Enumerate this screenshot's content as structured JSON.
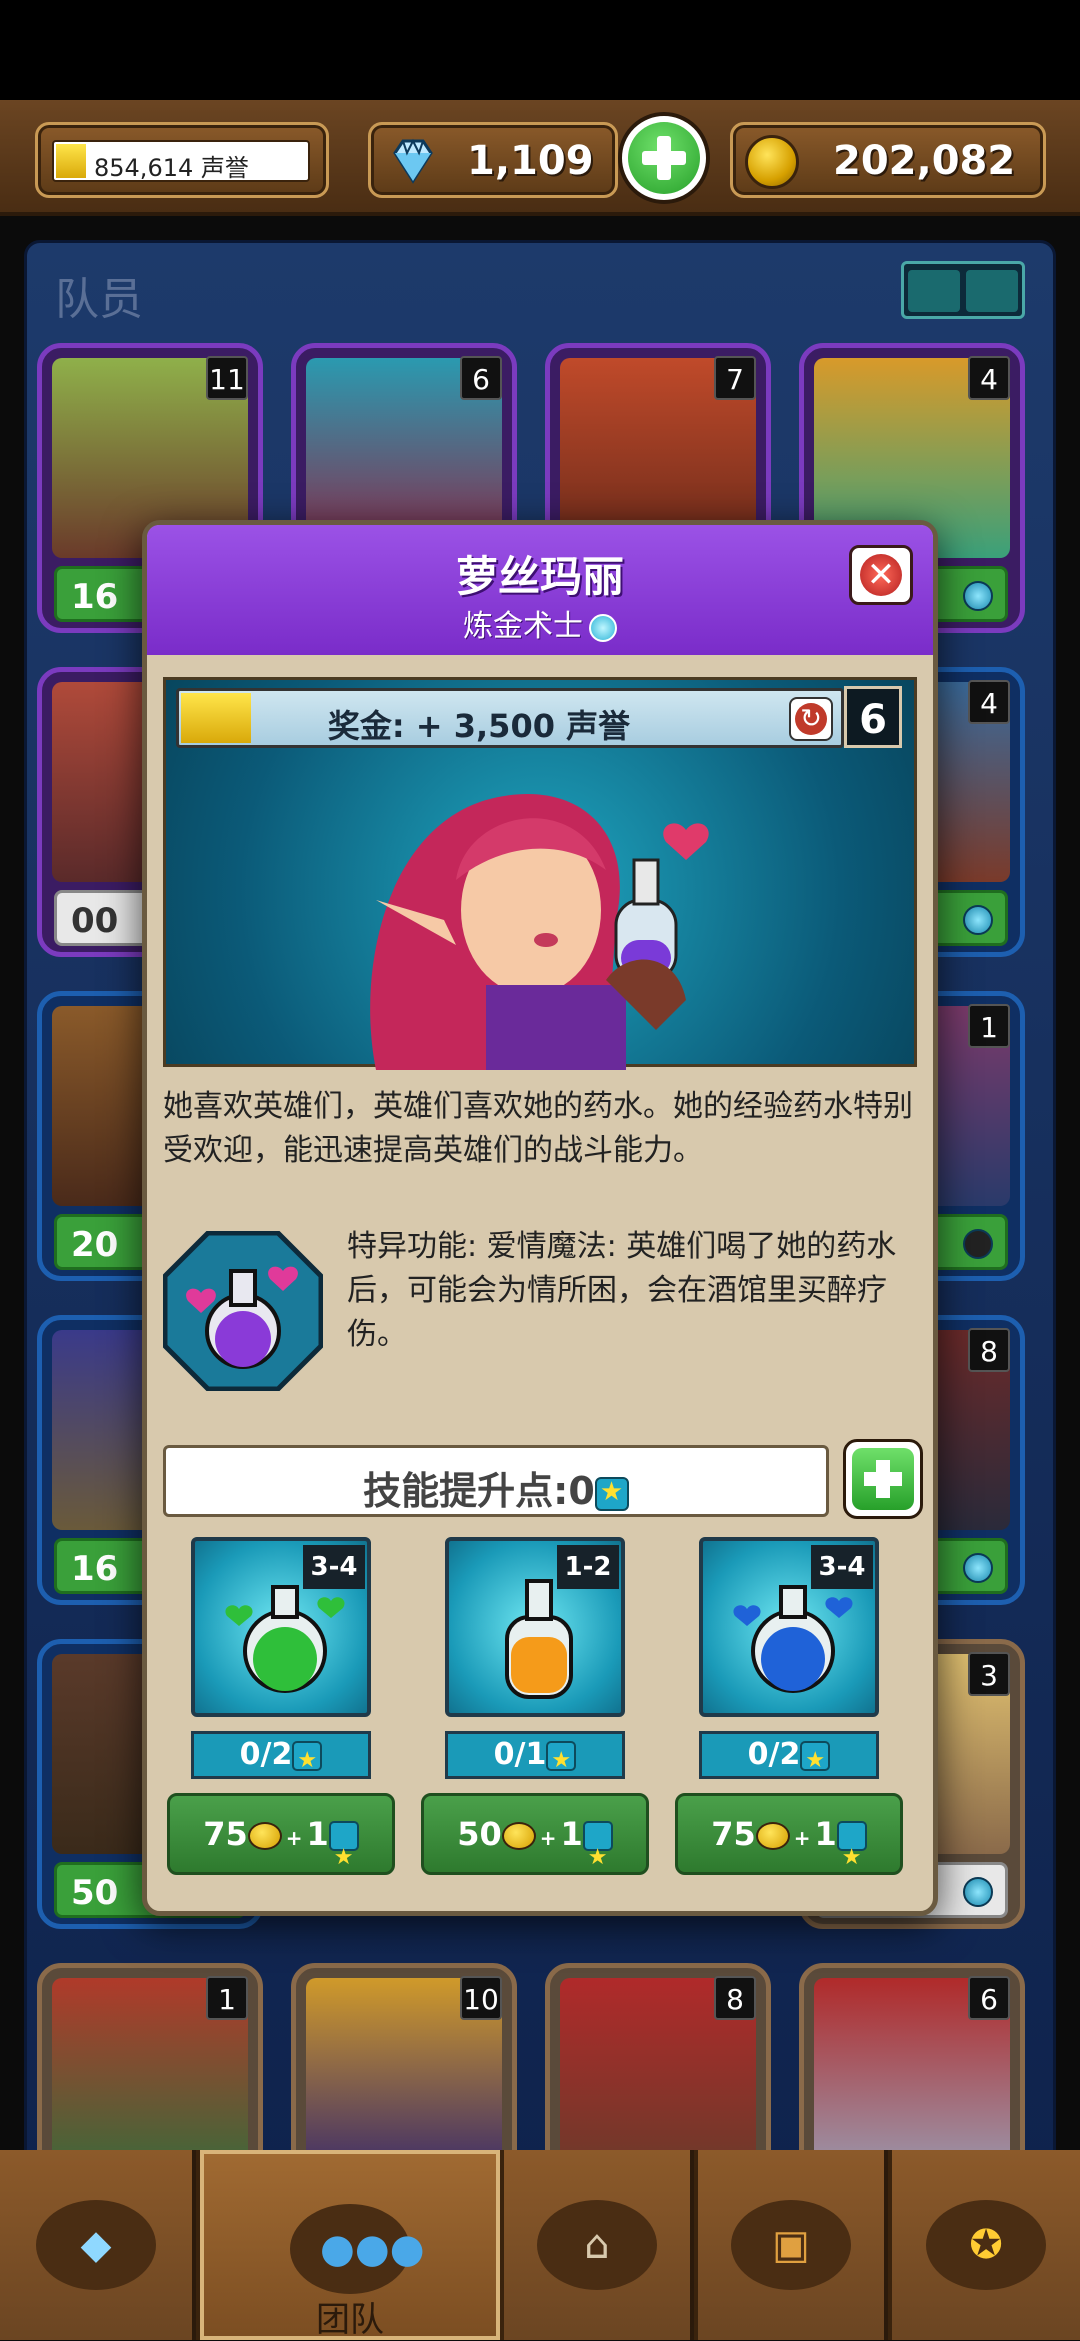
{
  "topbar": {
    "reputation": "854,614 声誉",
    "gems": "1,109",
    "gold": "202,082"
  },
  "roster": {
    "title": "队员",
    "cards": [
      {
        "level": "11",
        "foot": "16"
      },
      {
        "level": "6",
        "foot": ""
      },
      {
        "level": "7",
        "foot": ""
      },
      {
        "level": "4",
        "foot": ""
      },
      {
        "level": "",
        "foot": "00"
      },
      {
        "level": "4",
        "foot": ""
      },
      {
        "level": "",
        "foot": "20"
      },
      {
        "level": "1",
        "foot": ""
      },
      {
        "level": "",
        "foot": "16"
      },
      {
        "level": "8",
        "foot": ""
      },
      {
        "level": "",
        "foot": "50"
      },
      {
        "level": "3",
        "foot": ""
      },
      {
        "level": "1",
        "foot": ""
      },
      {
        "level": "10",
        "foot": ""
      },
      {
        "level": "8",
        "foot": ""
      },
      {
        "level": "6",
        "foot": ""
      }
    ]
  },
  "modal": {
    "name": "萝丝玛丽",
    "class": "炼金术士",
    "bonus": "奖金: + 3,500 声誉",
    "level": "6",
    "description": "她喜欢英雄们，英雄们喜欢她的药水。她的经验药水特别受欢迎，能迅速提高英雄们的战斗能力。",
    "trait": "特异功能: 爱情魔法: 英雄们喝了她的药水后，可能会为情所困，会在酒馆里买醉疗伤。",
    "skill_points": "技能提升点:0",
    "skills": [
      {
        "range": "3-4",
        "progress": "0/2",
        "cost_gold": "75",
        "cost_star": "1",
        "potion": "green-potion-icon",
        "color": "#2fbf3a"
      },
      {
        "range": "1-2",
        "progress": "0/1",
        "cost_gold": "50",
        "cost_star": "1",
        "potion": "orange-potion-icon",
        "color": "#f59b1a"
      },
      {
        "range": "3-4",
        "progress": "0/2",
        "cost_gold": "75",
        "cost_star": "1",
        "potion": "blue-potion-icon",
        "color": "#1f62d8"
      }
    ]
  },
  "tabs": [
    {
      "icon": "gem-icon",
      "label": ""
    },
    {
      "icon": "team-icon",
      "label": "团队"
    },
    {
      "icon": "tavern-icon",
      "label": ""
    },
    {
      "icon": "chest-icon",
      "label": ""
    },
    {
      "icon": "medal-icon",
      "label": ""
    }
  ]
}
